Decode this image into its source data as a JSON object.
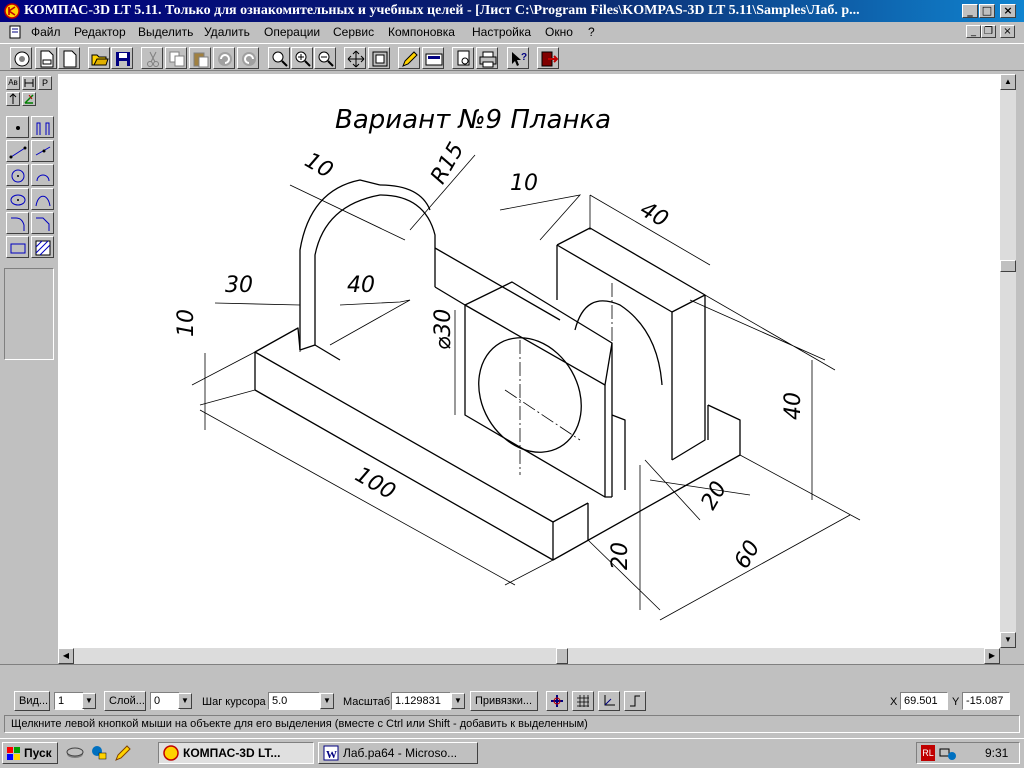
{
  "window": {
    "title": "КОМПАС-3D LT 5.11. Только для ознакомительных и учебных целей - [Лист C:\\Program Files\\KOMPAS-3D LT 5.11\\Samples\\Лаб. р...",
    "minimize": "_",
    "maximize": "□",
    "close": "×"
  },
  "menu": [
    "Файл",
    "Редактор",
    "Выделить",
    "Удалить",
    "Операции",
    "Сервис",
    "Компоновка",
    "Настройка",
    "Окно",
    "?"
  ],
  "mdi": {
    "minimize": "_",
    "restore": "❐",
    "close": "×"
  },
  "toolbar": [
    "preview-icon",
    "new-document-icon",
    "new-sheet-icon",
    "open-folder-icon",
    "save-icon",
    "cut-icon",
    "copy-icon",
    "paste-icon",
    "undo-icon",
    "redo-icon",
    "zoom-in-frame-icon",
    "zoom-in-icon",
    "zoom-out-icon",
    "pan-icon",
    "zoom-all-icon",
    "pencil-icon",
    "calculator-icon",
    "print-preview-icon",
    "printer-icon",
    "help-pointer-icon",
    "exit-icon"
  ],
  "left_panel": {
    "tabs": [
      "Ав",
      "Р"
    ]
  },
  "drawing": {
    "title": "Вариант №9 Планка",
    "dims": [
      "10",
      "R15",
      "10",
      "40",
      "30",
      "40",
      "10",
      "⌀30",
      "40",
      "100",
      "20",
      "60",
      "20"
    ]
  },
  "params": {
    "view_button": "Вид...",
    "view_value": "1",
    "layer_button": "Слой...",
    "layer_value": "0",
    "step_label": "Шаг курсора",
    "step_value": "5.0",
    "scale_label": "Масштаб",
    "scale_value": "1.129831",
    "snaps_button": "Привязки...",
    "x_label": "X",
    "x_value": "69.501",
    "y_label": "Y",
    "y_value": "-15.087"
  },
  "status": "Щелкните левой кнопкой мыши на объекте для его выделения (вместе с Ctrl или Shift - добавить к выделенным)",
  "taskbar": {
    "start": "Пуск",
    "tasks": [
      "КОМПАС-3D LT...",
      "Лаб.ра64 - Microso..."
    ],
    "tray_lang": "RL",
    "time": "9:31"
  }
}
